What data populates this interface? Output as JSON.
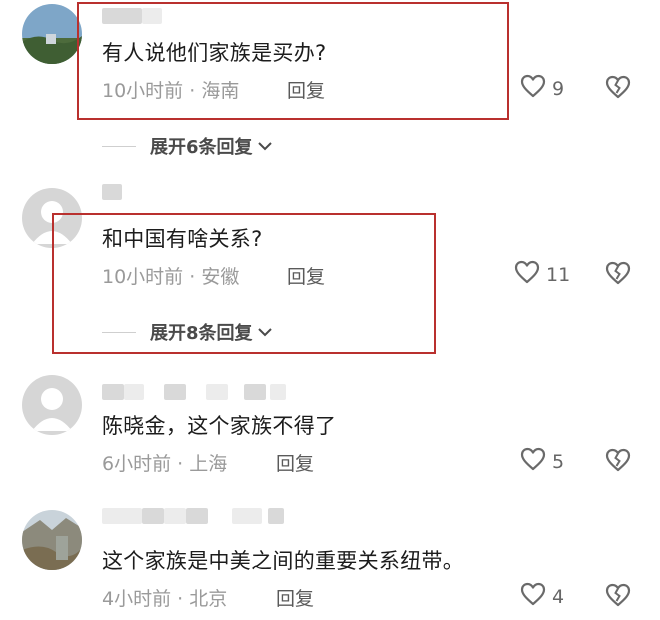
{
  "comments": [
    {
      "text": "有人说他们家族是买办?",
      "time": "10小时前",
      "location": "海南",
      "reply": "回复",
      "likes": "9"
    },
    {
      "text": "和中国有啥关系?",
      "time": "10小时前",
      "location": "安徽",
      "reply": "回复",
      "likes": "11"
    },
    {
      "text": "陈晓金，这个家族不得了",
      "time": "6小时前",
      "location": "上海",
      "reply": "回复",
      "likes": "5"
    },
    {
      "text": "这个家族是中美之间的重要关系纽带。",
      "time": "4小时前",
      "location": "北京",
      "reply": "回复",
      "likes": "4"
    }
  ],
  "expands": [
    {
      "label": "展开6条回复"
    },
    {
      "label": "展开8条回复"
    }
  ],
  "meta_separator": "·",
  "colors": {
    "highlight_box": "#b9302e",
    "meta_text": "#9a9a9a"
  },
  "icons": {
    "like": "heart-outline-icon",
    "dislike": "broken-heart-icon",
    "expand": "chevron-down-icon"
  }
}
